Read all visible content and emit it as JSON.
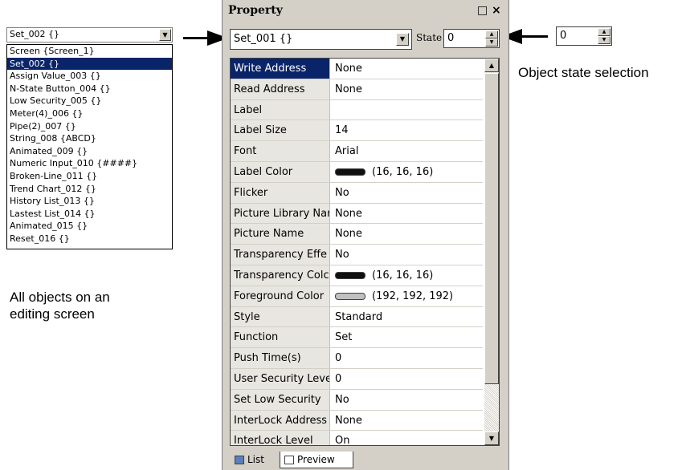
{
  "objects_dropdown": {
    "selected": "Set_002 {}",
    "items": [
      "Screen {Screen_1}",
      "Set_002 {}",
      "Assign Value_003 {}",
      "N-State Button_004 {}",
      "Low Security_005 {}",
      "Meter(4)_006 {}",
      "Pipe(2)_007 {}",
      "String_008 {ABCD}",
      "Animated_009 {}",
      "Numeric Input_010 {####}",
      "Broken-Line_011 {}",
      "Trend Chart_012 {}",
      "History List_013 {}",
      "Lastest List_014 {}",
      "Animated_015 {}",
      "Reset_016 {}"
    ],
    "selected_index": 1
  },
  "captions": {
    "all_objects_line1": "All objects on an",
    "all_objects_line2": "editing screen",
    "state_selection": "Object state selection"
  },
  "external_state_spinner": {
    "value": "0"
  },
  "property_panel": {
    "title": "Property",
    "restore_symbol": "□",
    "close_symbol": "×",
    "object_combo": "Set_001 {}",
    "state_label": "State",
    "state_value": "0",
    "rows": [
      {
        "name": "Write Address",
        "value": "None",
        "selected": true
      },
      {
        "name": "Read Address",
        "value": "None"
      },
      {
        "name": "Label",
        "value": ""
      },
      {
        "name": "Label Size",
        "value": "14"
      },
      {
        "name": "Font",
        "value": "Arial"
      },
      {
        "name": "Label Color",
        "value": "(16, 16, 16)",
        "swatch": "#101010"
      },
      {
        "name": "Flicker",
        "value": "No"
      },
      {
        "name": "Picture Library Nar",
        "value": "None"
      },
      {
        "name": "Picture Name",
        "value": "None"
      },
      {
        "name": "Transparency Effe",
        "value": "No"
      },
      {
        "name": "Transparency Colc",
        "value": "(16, 16, 16)",
        "swatch": "#101010"
      },
      {
        "name": "Foreground Color",
        "value": "(192, 192, 192)",
        "swatch": "#c0c0c0"
      },
      {
        "name": "Style",
        "value": "Standard"
      },
      {
        "name": "Function",
        "value": "Set"
      },
      {
        "name": "Push Time(s)",
        "value": "0"
      },
      {
        "name": "User Security Leve",
        "value": "0"
      },
      {
        "name": "Set Low Security",
        "value": "No"
      },
      {
        "name": "InterLock Address",
        "value": "None"
      },
      {
        "name": "InterLock Level",
        "value": "On"
      }
    ],
    "tabs": [
      {
        "label": "List",
        "icon": "list-icon"
      },
      {
        "label": "Preview",
        "icon": "preview-icon"
      }
    ]
  },
  "colors": {
    "selection": "#0a246a",
    "panel_bg": "#d4d0c8"
  }
}
